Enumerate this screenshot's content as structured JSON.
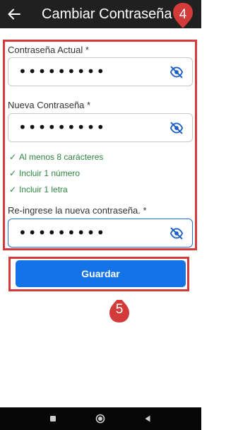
{
  "appbar": {
    "title": "Cambiar Contraseña",
    "back_icon": "arrow-left-icon",
    "background": "#202020"
  },
  "markers": {
    "form": "4",
    "button": "5",
    "color": "#d33a3a"
  },
  "form": {
    "current_password": {
      "label": "Contraseña Actual *",
      "value": "•••••••••",
      "icon": "eye-off-icon"
    },
    "new_password": {
      "label": "Nueva Contraseña *",
      "value": "•••••••••",
      "icon": "eye-off-icon"
    },
    "rules": [
      {
        "text": "Al menos 8 carácteres",
        "icon": "check-icon"
      },
      {
        "text": "Incluir 1 número",
        "icon": "check-icon"
      },
      {
        "text": "Incluir 1 letra",
        "icon": "check-icon"
      }
    ],
    "confirm_password": {
      "label": "Re-ingrese la nueva contraseña. *",
      "value": "•••••••••",
      "icon": "eye-off-icon"
    },
    "accent_color": "#1f6fe0",
    "rule_color": "#2e8540"
  },
  "save_button": {
    "label": "Guardar",
    "color": "#1573e8"
  },
  "navbar": {
    "items": [
      "square-icon",
      "circle-icon",
      "triangle-back-icon"
    ]
  }
}
